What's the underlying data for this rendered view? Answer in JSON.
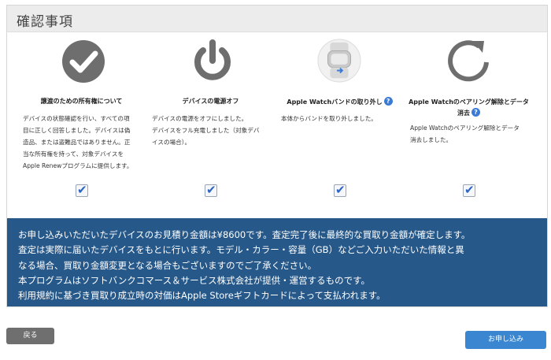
{
  "header": {
    "title": "確認事項"
  },
  "steps": [
    {
      "icon": "checkmark-circle-icon",
      "title": "譲渡のための所有権について",
      "desc": [
        "デバイスの状態確認を行い、すべての項",
        "目に正しく回答しました。デバイスは偽",
        "造品、または盗難品ではありません。正",
        "当な所有権を持って、対象デバイスを",
        "Apple Renewプログラムに提供します。"
      ],
      "checked": true
    },
    {
      "icon": "power-icon",
      "title": "デバイスの電源オフ",
      "desc": [
        "デバイスの電源をオフにしました。",
        "デバイスをフル充電しました（対象デバ",
        "イスの場合）。"
      ],
      "checked": true
    },
    {
      "icon": "apple-watch-band-icon",
      "title": "Apple Watchバンドの取り外し",
      "help": "?",
      "desc": [
        "本体からバンドを取り外しました。"
      ],
      "checked": true
    },
    {
      "icon": "refresh-icon",
      "title_lines": [
        "Apple Watchのペアリング解除とデータ",
        "消去"
      ],
      "help": "?",
      "desc": [
        "Apple Watchのペアリング解除とデータ",
        "消去しました。"
      ],
      "checked": true
    }
  ],
  "checkbox_mark": "✔",
  "notice": {
    "lines": [
      "お申し込みいただいたデバイスのお見積り金額は¥8600です。査定完了後に最終的な買取り金額が確定します。",
      "査定は実際に届いたデバイスをもとに行います。モデル・カラー・容量（GB）などご入力いただいた情報と異",
      "なる場合、買取り金額変更となる場合もございますのでご了承ください。",
      "本プログラムはソフトバンクコマース＆サービス株式会社が提供・運営するものです。",
      "利用規約に基づき買取り成立時の対価はApple Storeギフトカードによって支払われます。"
    ]
  },
  "buttons": {
    "back": "戻る",
    "apply": "お申し込み"
  },
  "colors": {
    "notice_bg": "#26588a",
    "icon_gray": "#6e6e6e",
    "check_blue": "#2a63c4",
    "apply_bg": "#3a86d0",
    "back_bg": "#6f6f6f"
  }
}
